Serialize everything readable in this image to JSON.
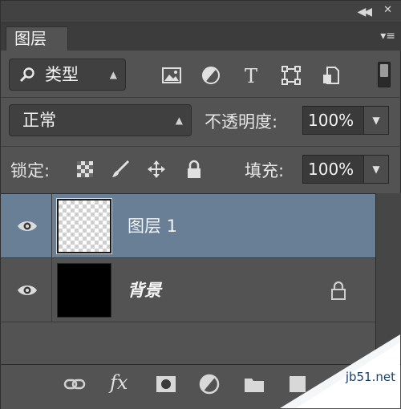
{
  "panel": {
    "tab_label": "图层",
    "collapse_glyph": "◀◀",
    "close_glyph": "✕",
    "menu_glyph": "▾≡"
  },
  "filter": {
    "kind_label": "类型",
    "icons": [
      "image-filter-icon",
      "adjustment-filter-icon",
      "type-filter-icon",
      "shape-filter-icon",
      "smart-object-filter-icon"
    ],
    "type_glyph": "T"
  },
  "blend": {
    "mode": "正常",
    "opacity_label": "不透明度:",
    "opacity_value": "100%"
  },
  "lock": {
    "label": "锁定:",
    "fill_label": "填充:",
    "fill_value": "100%"
  },
  "layers": [
    {
      "name": "图层 1",
      "selected": true,
      "visible": true,
      "thumb": "transparent"
    },
    {
      "name": "背景",
      "selected": false,
      "visible": true,
      "thumb": "black",
      "locked": true
    }
  ],
  "bottom_toolbar": {
    "fx_label": "fx"
  },
  "watermark": "jb51.net",
  "colors": {
    "panel_bg": "#535353",
    "selected_row": "#687f96",
    "tab_strip": "#3c3c3c"
  }
}
